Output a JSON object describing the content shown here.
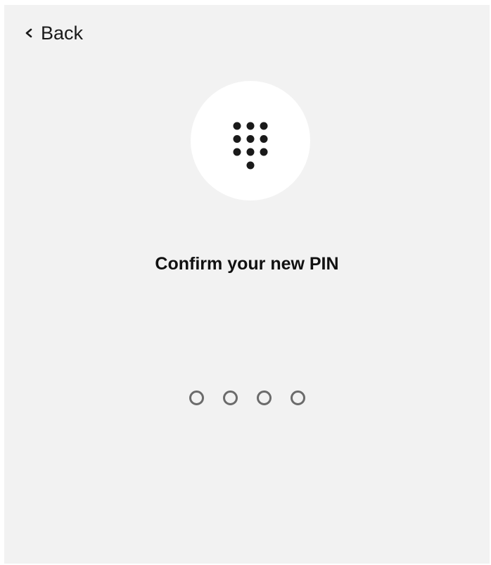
{
  "header": {
    "back_label": "Back",
    "back_icon": "chevron-left-icon"
  },
  "hero": {
    "icon": "dialpad-icon"
  },
  "title": "Confirm your new PIN",
  "pin": {
    "length": 4,
    "entered": 0
  },
  "colors": {
    "background": "#f2f2f2",
    "icon_circle": "#ffffff",
    "text": "#111111",
    "pin_dot_stroke": "#6b6b6b"
  }
}
